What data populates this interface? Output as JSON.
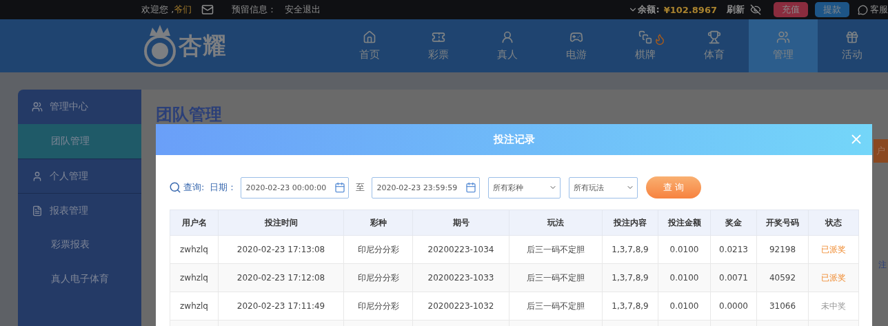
{
  "top_bar": {
    "greeting": "欢迎您 ,",
    "user": "爷们",
    "reserved_label": "预留信息：",
    "logout": "安全退出",
    "balance_label": "余额:",
    "balance": "¥102.8967",
    "refresh": "刷新",
    "deposit": "充值",
    "withdraw": "提款",
    "support": "客服"
  },
  "header": {
    "logo_text": "杏耀",
    "nav": [
      {
        "label": "首页",
        "selected": false
      },
      {
        "label": "彩票",
        "selected": false
      },
      {
        "label": "真人",
        "selected": false
      },
      {
        "label": "电游",
        "selected": false
      },
      {
        "label": "棋牌",
        "selected": false
      },
      {
        "label": "体育",
        "selected": false
      },
      {
        "label": "管理",
        "selected": true
      },
      {
        "label": "活动",
        "selected": false
      }
    ]
  },
  "sidebar": {
    "sections": [
      {
        "label": "管理中心",
        "children": [
          {
            "label": "团队管理",
            "selected": true
          }
        ]
      },
      {
        "label": "个人管理"
      },
      {
        "label": "报表管理",
        "children": [
          {
            "label": "彩票报表",
            "selected": false
          },
          {
            "label": "真人电子体育",
            "selected": false
          }
        ]
      }
    ]
  },
  "content": {
    "title": "团队管理",
    "button_fragment": "户",
    "text_fragment": "注"
  },
  "modal": {
    "title": "投注记录",
    "filters": {
      "query_label": "查询:",
      "date_label": "日期：",
      "start": "2020-02-23 00:00:00",
      "separator": "至",
      "end": "2020-02-23 23:59:59",
      "lottery_select": "所有彩种",
      "play_select": "所有玩法",
      "submit": "查 询"
    },
    "table": {
      "columns": [
        "用户名",
        "投注时间",
        "彩种",
        "期号",
        "玩法",
        "投注内容",
        "投注金额",
        "奖金",
        "开奖号码",
        "状态"
      ],
      "rows": [
        {
          "cells": [
            "zwhzlq",
            "2020-02-23 17:13:08",
            "印尼分分彩",
            "20200223-1034",
            "后三一码不定胆",
            "1,3,7,8,9",
            "0.0100",
            "0.0213",
            "92198",
            "已派奖"
          ],
          "kind": "paid"
        },
        {
          "cells": [
            "zwhzlq",
            "2020-02-23 17:12:08",
            "印尼分分彩",
            "20200223-1033",
            "后三一码不定胆",
            "1,3,7,8,9",
            "0.0100",
            "0.0071",
            "40592",
            "已派奖"
          ],
          "kind": "paid"
        },
        {
          "cells": [
            "zwhzlq",
            "2020-02-23 17:11:49",
            "印尼分分彩",
            "20200223-1032",
            "后三一码不定胆",
            "1,3,7,8,9",
            "0.0100",
            "0.0000",
            "31066",
            "未中奖"
          ],
          "kind": "lost"
        }
      ]
    }
  }
}
